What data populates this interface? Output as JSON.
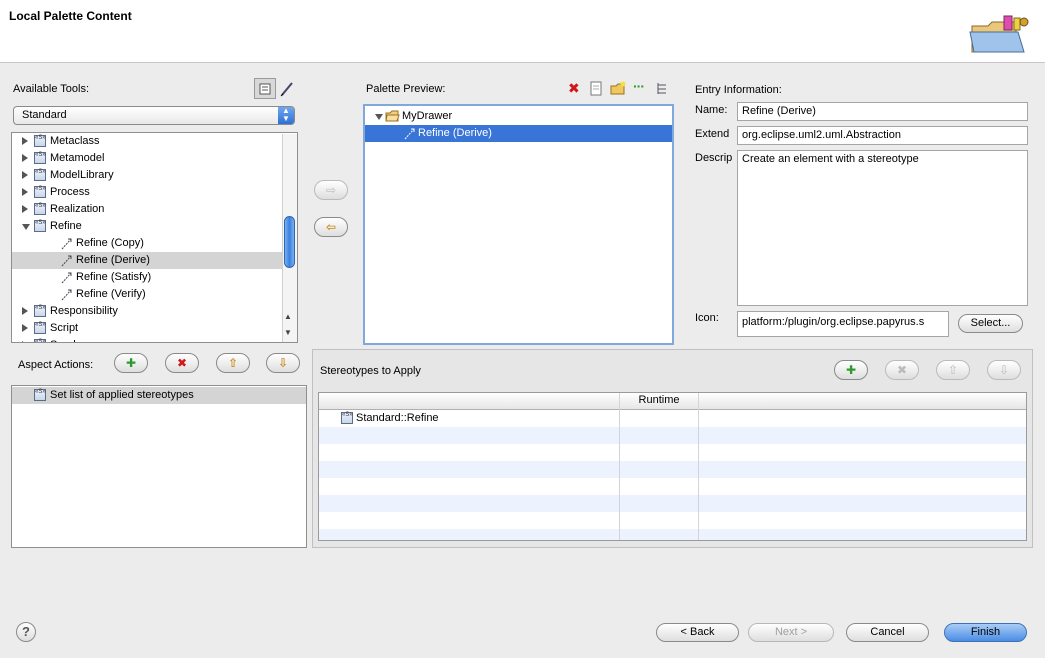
{
  "header": {
    "title": "Local Palette Content"
  },
  "available_tools": {
    "label": "Available Tools:",
    "combo_value": "Standard",
    "items": [
      {
        "label": "Metaclass",
        "kind": "stereotype",
        "expander": "collapsed",
        "indent": 0
      },
      {
        "label": "Metamodel",
        "kind": "stereotype",
        "expander": "collapsed",
        "indent": 0
      },
      {
        "label": "ModelLibrary",
        "kind": "stereotype",
        "expander": "collapsed",
        "indent": 0
      },
      {
        "label": "Process",
        "kind": "stereotype",
        "expander": "collapsed",
        "indent": 0
      },
      {
        "label": "Realization",
        "kind": "stereotype",
        "expander": "collapsed",
        "indent": 0
      },
      {
        "label": "Refine",
        "kind": "stereotype",
        "expander": "expanded",
        "indent": 0
      },
      {
        "label": "Refine (Copy)",
        "kind": "tool",
        "expander": "none",
        "indent": 1
      },
      {
        "label": "Refine (Derive)",
        "kind": "tool",
        "expander": "none",
        "indent": 1,
        "selected": true
      },
      {
        "label": "Refine (Satisfy)",
        "kind": "tool",
        "expander": "none",
        "indent": 1
      },
      {
        "label": "Refine (Verify)",
        "kind": "tool",
        "expander": "none",
        "indent": 1
      },
      {
        "label": "Responsibility",
        "kind": "stereotype",
        "expander": "collapsed",
        "indent": 0
      },
      {
        "label": "Script",
        "kind": "stereotype",
        "expander": "collapsed",
        "indent": 0
      },
      {
        "label": "Send",
        "kind": "stereotype",
        "expander": "collapsed",
        "indent": 0
      }
    ]
  },
  "palette_preview": {
    "label": "Palette Preview:",
    "drawer": "MyDrawer",
    "entry": "Refine (Derive)"
  },
  "entry_information": {
    "label": "Entry Information:",
    "name_label": "Name:",
    "name_value": "Refine (Derive)",
    "extend_label": "Extend",
    "extend_value": "org.eclipse.uml2.uml.Abstraction",
    "description_label": "Descrip",
    "description_value": "Create an element with a stereotype",
    "icon_label": "Icon:",
    "icon_value": "platform:/plugin/org.eclipse.papyrus.s",
    "select_button": "Select..."
  },
  "aspect_actions": {
    "label": "Aspect Actions:",
    "items": [
      "Set list of applied stereotypes"
    ]
  },
  "stereotypes_to_apply": {
    "label": "Stereotypes to Apply",
    "columns": [
      "",
      "Runtime",
      ""
    ],
    "rows": [
      "Standard::Refine"
    ]
  },
  "footer": {
    "back": "< Back",
    "next": "Next >",
    "cancel": "Cancel",
    "finish": "Finish"
  }
}
